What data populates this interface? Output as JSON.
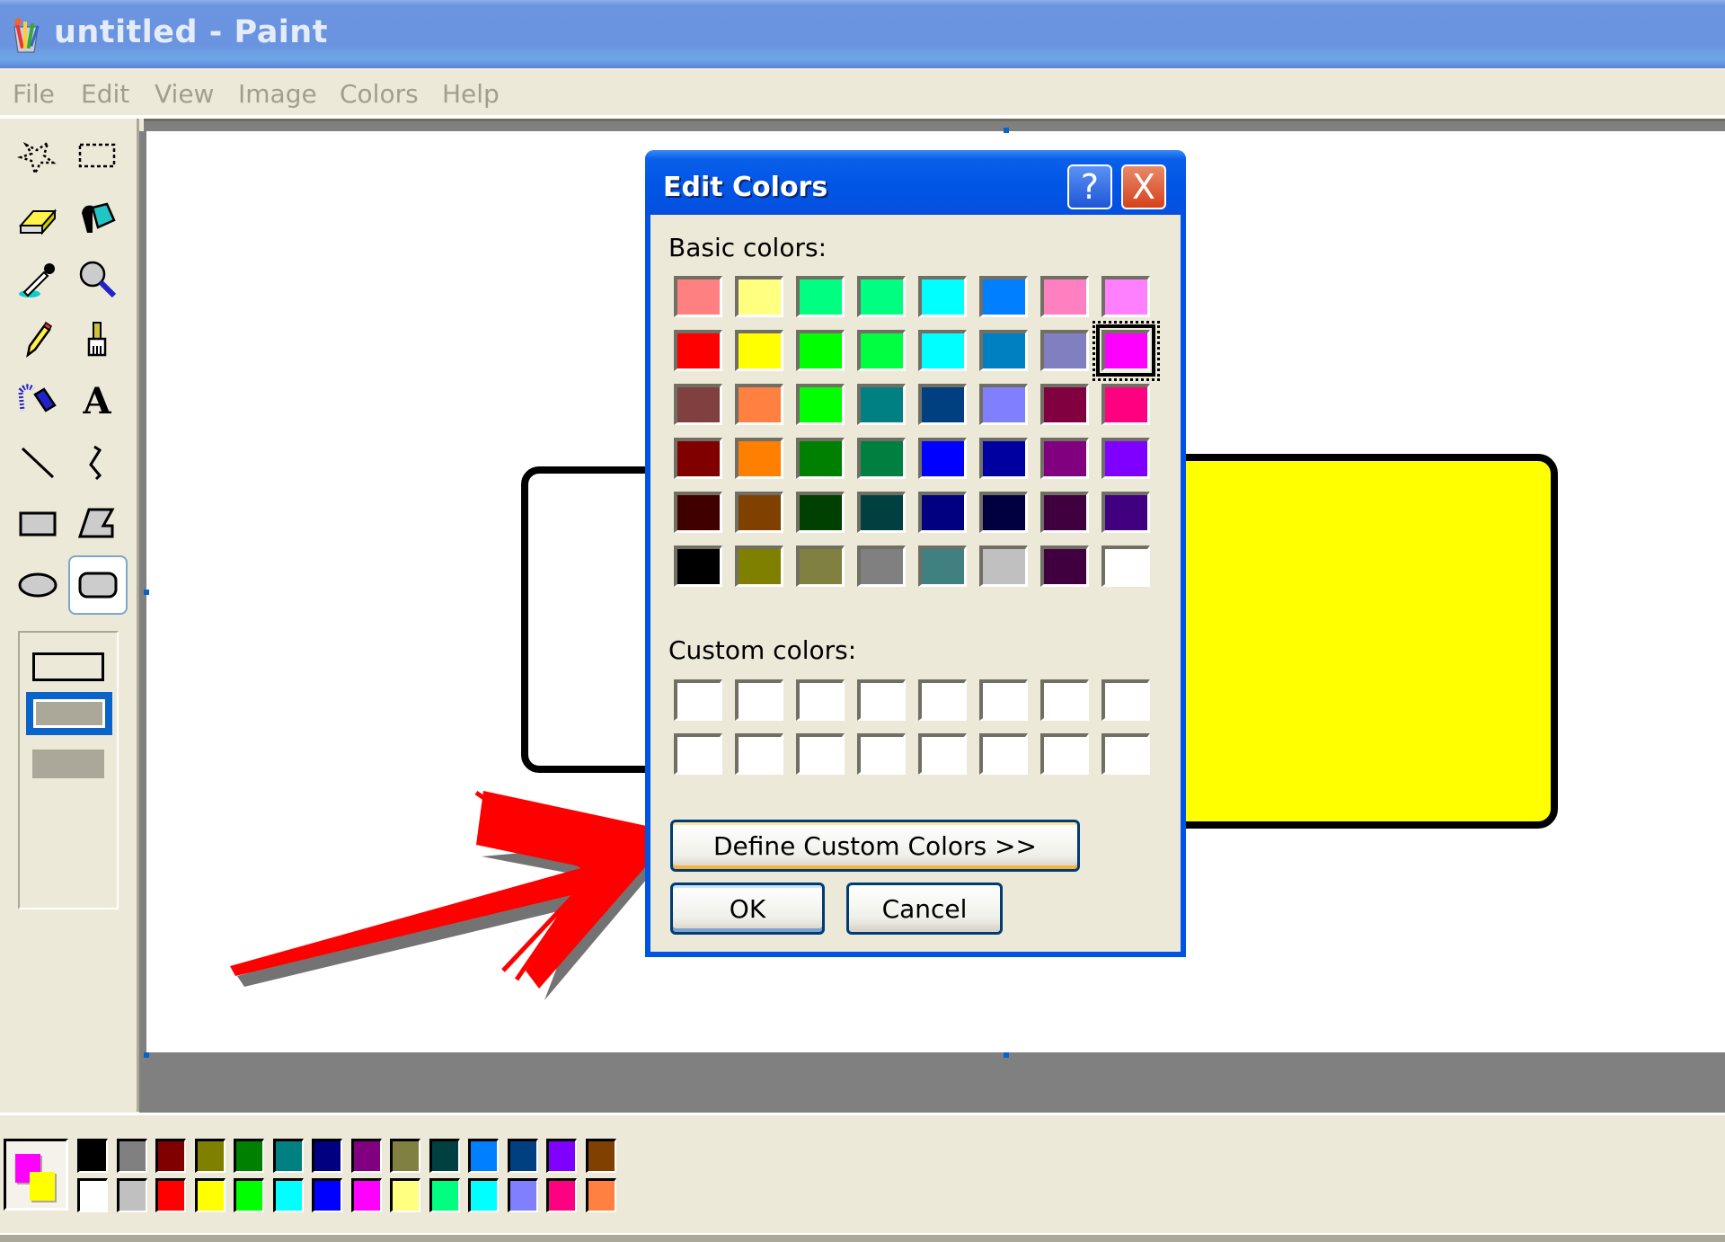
{
  "window": {
    "title": "untitled - Paint",
    "app_icon": "paint-app-icon"
  },
  "menu": [
    "File",
    "Edit",
    "View",
    "Image",
    "Colors",
    "Help"
  ],
  "toolbox": {
    "tools": [
      {
        "name": "free-form-select",
        "icon": "star-select-icon"
      },
      {
        "name": "rectangle-select",
        "icon": "rect-select-icon"
      },
      {
        "name": "eraser",
        "icon": "eraser-icon"
      },
      {
        "name": "fill-with-color",
        "icon": "paint-bucket-icon"
      },
      {
        "name": "pick-color",
        "icon": "eyedropper-icon"
      },
      {
        "name": "magnifier",
        "icon": "magnifier-icon"
      },
      {
        "name": "pencil",
        "icon": "pencil-icon"
      },
      {
        "name": "brush",
        "icon": "brush-icon"
      },
      {
        "name": "airbrush",
        "icon": "airbrush-icon"
      },
      {
        "name": "text",
        "icon": "text-icon",
        "glyph": "A"
      },
      {
        "name": "line",
        "icon": "line-icon"
      },
      {
        "name": "curve",
        "icon": "curve-icon"
      },
      {
        "name": "rectangle",
        "icon": "rectangle-icon"
      },
      {
        "name": "polygon",
        "icon": "polygon-icon"
      },
      {
        "name": "ellipse",
        "icon": "ellipse-icon"
      },
      {
        "name": "rounded-rectangle",
        "icon": "rounded-rectangle-icon",
        "selected": true
      }
    ],
    "fill_styles": [
      "outline",
      "outline-with-fill",
      "fill-only"
    ],
    "selected_fill_style": "outline-with-fill"
  },
  "colors": {
    "foreground": "#FF00FF",
    "background": "#FFFF00",
    "palette_top": [
      "#000000",
      "#808080",
      "#800000",
      "#808000",
      "#008000",
      "#008080",
      "#000080",
      "#800080",
      "#808040",
      "#004040",
      "#0080FF",
      "#004080",
      "#8000FF",
      "#804000"
    ],
    "palette_bottom": [
      "#FFFFFF",
      "#C0C0C0",
      "#FF0000",
      "#FFFF00",
      "#00FF00",
      "#00FFFF",
      "#0000FF",
      "#FF00FF",
      "#FFFF80",
      "#00FF80",
      "#00FFFF",
      "#8080FF",
      "#FF0080",
      "#FF8040"
    ]
  },
  "canvas": {
    "shapes": [
      {
        "type": "rounded-rectangle",
        "fill": "#FFFFFF",
        "stroke": "#000000"
      },
      {
        "type": "rounded-rectangle",
        "fill": "#FFFF00",
        "stroke": "#000000"
      }
    ],
    "annotation": {
      "type": "arrow",
      "color": "#FF0000",
      "points_to": "define-custom-colors-button"
    }
  },
  "dialog": {
    "title": "Edit Colors",
    "help_label": "?",
    "close_label": "X",
    "basic_colors_label": "Basic colors:",
    "basic_colors": [
      [
        "#FF8080",
        "#FFFF80",
        "#00FF80",
        "#00FF80",
        "#00FFFF",
        "#0080FF",
        "#FF80C0",
        "#FF80FF"
      ],
      [
        "#FF0000",
        "#FFFF00",
        "#00FF00",
        "#00FF40",
        "#00FFFF",
        "#0080C0",
        "#8080C0",
        "#FF00FF"
      ],
      [
        "#804040",
        "#FF8040",
        "#00FF00",
        "#008080",
        "#004080",
        "#8080FF",
        "#800040",
        "#FF0080"
      ],
      [
        "#800000",
        "#FF8000",
        "#008000",
        "#008040",
        "#0000FF",
        "#0000A0",
        "#800080",
        "#8000FF"
      ],
      [
        "#400000",
        "#804000",
        "#004000",
        "#004040",
        "#000080",
        "#000040",
        "#400040",
        "#400080"
      ],
      [
        "#000000",
        "#808000",
        "#808040",
        "#808080",
        "#408080",
        "#C0C0C0",
        "#400040",
        "#FFFFFF"
      ]
    ],
    "selected_basic_color": "#FF00FF",
    "custom_colors_label": "Custom colors:",
    "custom_colors": [
      [
        "#FFFFFF",
        "#FFFFFF",
        "#FFFFFF",
        "#FFFFFF",
        "#FFFFFF",
        "#FFFFFF",
        "#FFFFFF",
        "#FFFFFF"
      ],
      [
        "#FFFFFF",
        "#FFFFFF",
        "#FFFFFF",
        "#FFFFFF",
        "#FFFFFF",
        "#FFFFFF",
        "#FFFFFF",
        "#FFFFFF"
      ]
    ],
    "define_custom_label": "Define Custom Colors >>",
    "ok_label": "OK",
    "cancel_label": "Cancel"
  }
}
